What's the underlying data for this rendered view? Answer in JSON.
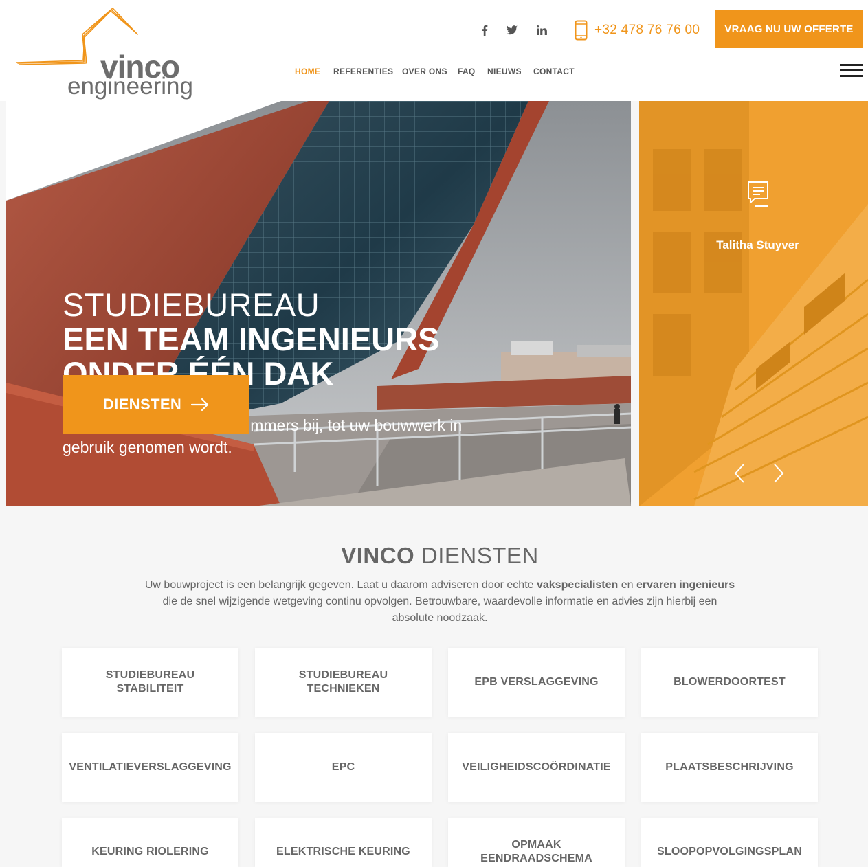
{
  "header": {
    "logo_word1": "vinco",
    "logo_word2": "engineering",
    "social": [
      "facebook-icon",
      "twitter-icon",
      "linkedin-icon"
    ],
    "phone": "+32 478 76 76 00",
    "cta": "VRAAG NU UW OFFERTE",
    "accent_color": "#f0951b"
  },
  "nav": {
    "items": [
      "HOME",
      "REFERENTIES",
      "OVER ONS",
      "FAQ",
      "NIEUWS",
      "CONTACT"
    ],
    "active": "HOME"
  },
  "hero": {
    "line1": "STUDIEBUREAU",
    "line2": "EEN TEAM INGENIEURS",
    "line3": "ONDER ÉÉN DAK",
    "text": "Vinco Engineering staat u immers bij, tot uw bouwwerk in gebruik genomen wordt.",
    "button": "DIENSTEN"
  },
  "testimonial": {
    "name": "Talitha Stuyver"
  },
  "services": {
    "title_bold": "VINCO",
    "title_rest": "DIENSTEN",
    "intro_1": "Uw bouwproject is een belangrijk gegeven. Laat u daarom adviseren door echte ",
    "intro_b1": "vakspecialisten",
    "intro_2": " en ",
    "intro_b2": "ervaren ingenieurs",
    "intro_3": " die de snel wijzigende wetgeving continu opvolgen. Betrouwbare, waardevolle informatie en advies zijn hierbij een absolute noodzaak.",
    "cards": [
      "STUDIEBUREAU STABILITEIT",
      "STUDIEBUREAU TECHNIEKEN",
      "EPB VERSLAGGEVING",
      "BLOWERDOORTEST",
      "VENTILATIEVERSLAGGEVING",
      "EPC",
      "VEILIGHEIDSCOÖRDINATIE",
      "PLAATSBESCHRIJVING",
      "KEURING RIOLERING",
      "ELEKTRISCHE KEURING",
      "OPMAAK EENDRAADSCHEMA",
      "SLOOPOPVOLGINGSPLAN"
    ]
  }
}
